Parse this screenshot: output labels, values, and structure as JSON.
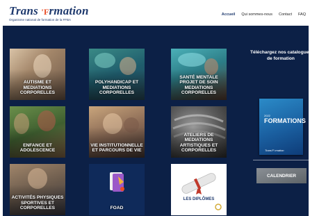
{
  "logo": {
    "title_part1": "Trans",
    "title_star": "'F",
    "title_part2": "rmation",
    "tagline": "Organisme national de formation de la FFBA"
  },
  "nav": {
    "items": [
      "Accueil",
      "Qui sommes-nous",
      "Contact",
      "FAQ"
    ]
  },
  "tiles": [
    {
      "label": "AUTISME ET MEDIATIONS CORPORELLES"
    },
    {
      "label": "POLYHANDICAP ET MEDIATIONS CORPORELLES"
    },
    {
      "label": "SANTÉ MENTALE PROJET DE SOIN MEDIATIONS CORPORELLES"
    },
    {
      "label": "ENFANCE ET ADOLESCENCE"
    },
    {
      "label": "VIE INSTITUTIONNELLE ET PARCOURS DE VIE"
    },
    {
      "label": "ATELIERS DE MEDIATIONS ARTISTIQUES ET CORPORELLES"
    },
    {
      "label": "ACTIVITÉS PHYSIQUES SPORTIVES ET CORPORELLES"
    },
    {
      "label": "FOAD"
    },
    {
      "label": "LES DIPLÔMES"
    }
  ],
  "sidebar": {
    "heading": "Téléchargez nos catalogues de formation",
    "catalogue": {
      "year": "2022",
      "title": "FORMATIONS",
      "logo": "Trans'F rmation"
    },
    "calendar_label": "CALENDRIER"
  },
  "colors": {
    "brand_navy": "#1f3a6e",
    "brand_orange": "#e84b24",
    "main_background": "#0c2046"
  }
}
